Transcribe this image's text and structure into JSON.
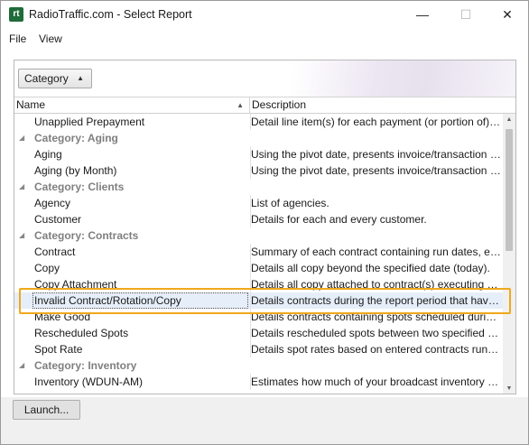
{
  "window": {
    "app_icon_text": "rt",
    "title": "RadioTraffic.com - Select Report",
    "minimize_glyph": "—",
    "maximize_glyph": "☐",
    "close_glyph": "✕"
  },
  "menu": {
    "file": "File",
    "view": "View"
  },
  "group_button": {
    "label": "Category",
    "arrow": "▲"
  },
  "columns": {
    "name": "Name",
    "name_sort_glyph": "▲",
    "description": "Description"
  },
  "rows": [
    {
      "type": "item",
      "name": "Unapplied Prepayment",
      "desc": "Detail line item(s) for each payment (or portion of) still unapplied"
    },
    {
      "type": "category",
      "caret": "◢",
      "label": "Category: Aging"
    },
    {
      "type": "item",
      "name": "Aging",
      "desc": "Using the pivot date, presents invoice/transaction aging"
    },
    {
      "type": "item",
      "name": "Aging (by Month)",
      "desc": "Using the pivot date, presents invoice/transaction aging by month"
    },
    {
      "type": "category",
      "caret": "◢",
      "label": "Category: Clients"
    },
    {
      "type": "item",
      "name": "Agency",
      "desc": "List of agencies."
    },
    {
      "type": "item",
      "name": "Customer",
      "desc": "Details for each and every customer."
    },
    {
      "type": "category",
      "caret": "◢",
      "label": "Category: Contracts"
    },
    {
      "type": "item",
      "name": "Contract",
      "desc": "Summary of each contract containing run dates, etc."
    },
    {
      "type": "item",
      "name": "Copy",
      "desc": "Details all copy beyond the specified date (today)."
    },
    {
      "type": "item",
      "name": "Copy Attachment",
      "desc": "Details all copy attached to contract(s) executing during the period"
    },
    {
      "type": "item",
      "selected": true,
      "name": "Invalid Contract/Rotation/Copy",
      "desc": "Details contracts during the report period that have missing data"
    },
    {
      "type": "item",
      "name": "Make Good",
      "desc": "Details contracts containing spots scheduled during the period"
    },
    {
      "type": "item",
      "name": "Rescheduled Spots",
      "desc": "Details rescheduled spots between two specified dates."
    },
    {
      "type": "item",
      "name": "Spot Rate",
      "desc": "Details spot rates based on entered contracts running during the period"
    },
    {
      "type": "category",
      "caret": "◢",
      "label": "Category: Inventory"
    },
    {
      "type": "item",
      "name": "Inventory (WDUN-AM)",
      "desc": "Estimates how much of your broadcast inventory for the station"
    }
  ],
  "scrollbar": {
    "up_glyph": "▲",
    "down_glyph": "▼"
  },
  "footer": {
    "launch_label": "Launch..."
  },
  "colors": {
    "highlight_border": "#f0a81c",
    "selected_row": "#e6eef9",
    "category_text": "#7f7f7f",
    "app_icon": "#1f6b3a"
  }
}
